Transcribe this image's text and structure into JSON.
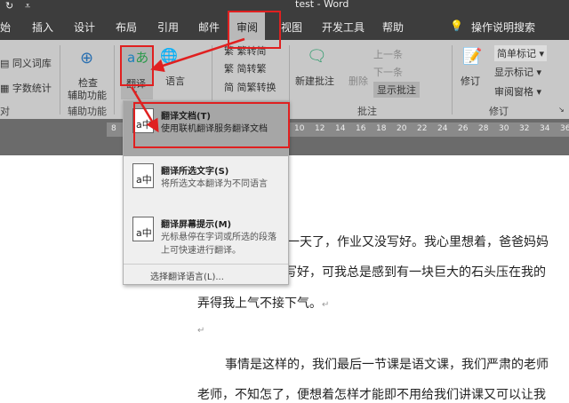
{
  "title_bar": {
    "title": "test  -  Word",
    "quick_access": [
      "↻",
      "⩡"
    ]
  },
  "tabs": [
    {
      "label": "始"
    },
    {
      "label": "插入"
    },
    {
      "label": "设计"
    },
    {
      "label": "布局"
    },
    {
      "label": "引用"
    },
    {
      "label": "邮件"
    },
    {
      "label": "审阅",
      "active": true
    },
    {
      "label": "视图"
    },
    {
      "label": "开发工具"
    },
    {
      "label": "帮助"
    }
  ],
  "search": {
    "label": "操作说明搜索"
  },
  "ribbon": {
    "proofing": {
      "thesaurus": "同义词库",
      "word_count": "字数统计",
      "group": "对"
    },
    "accessibility": {
      "check": "检查",
      "check2": "辅助功能",
      "group": "辅助功能"
    },
    "translate": {
      "label": "翻译",
      "language": "语言"
    },
    "chinese": {
      "t2s": "繁转简",
      "s2t": "简转繁",
      "convert": "简繁转换"
    },
    "comments": {
      "new": "新建批注",
      "delete": "删除",
      "prev": "上一条",
      "next": "下一条",
      "show": "显示批注",
      "group": "批注"
    },
    "tracking": {
      "track": "修订",
      "markup": "简单标记",
      "show_markup": "显示标记",
      "pane": "审阅窗格",
      "group": "修订"
    }
  },
  "ruler": {
    "numbers": [
      "8",
      "10",
      "12",
      "14",
      "16",
      "18",
      "20",
      "22",
      "24",
      "26",
      "28",
      "30",
      "32",
      "34",
      "36"
    ]
  },
  "translate_menu": {
    "items": [
      {
        "title": "翻译文档(T)",
        "desc": "使用联机翻译服务翻译文档"
      },
      {
        "title": "翻译所选文字(S)",
        "desc": "将所选文本翻译为不同语言"
      },
      {
        "title": "翻译屏幕提示(M)",
        "desc": "光标悬停在字词或所选的段落上可快速进行翻译。"
      }
    ],
    "footer": "选择翻译语言(L)..."
  },
  "document": {
    "line1": "一天了，作业又没写好。我心里想着，爸爸妈妈",
    "line2": "写好，可我总是感到有一块巨大的石头压在我的",
    "line3": "弄得我上气不接下气。",
    "line5": "事情是这样的，我们最后一节课是语文课，我们严肃的老师",
    "line6": "老师，不知怎了，便想着怎样才能即不用给我们讲课又可以让我",
    "para_mark": "↵"
  },
  "colors": {
    "annotation": "#e02020",
    "dark_chrome": "#3d3d3d",
    "ribbon": "#c8c8c8"
  }
}
